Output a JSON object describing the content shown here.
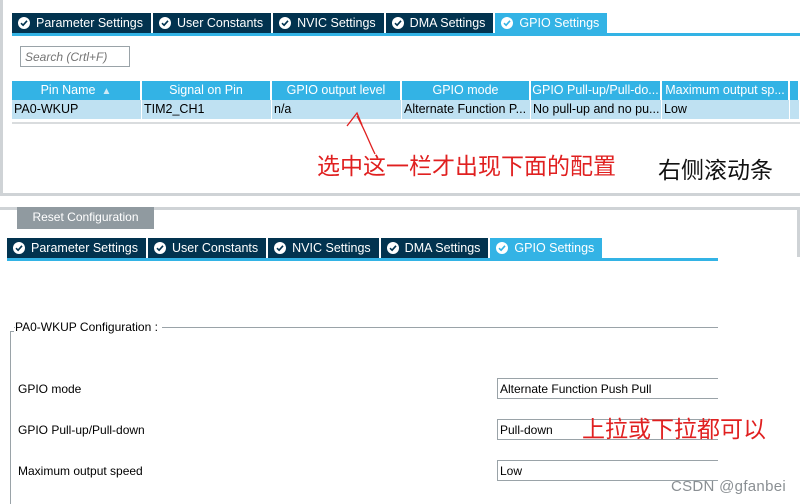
{
  "tabs": [
    {
      "label": "Parameter Settings",
      "active": false
    },
    {
      "label": "User Constants",
      "active": false
    },
    {
      "label": "NVIC Settings",
      "active": false
    },
    {
      "label": "DMA Settings",
      "active": false
    },
    {
      "label": "GPIO Settings",
      "active": true
    }
  ],
  "search": {
    "placeholder": "Search (Crtl+F)"
  },
  "table": {
    "columns": [
      "Pin Name",
      "Signal on Pin",
      "GPIO output level",
      "GPIO mode",
      "GPIO Pull-up/Pull-do...",
      "Maximum output sp...",
      ""
    ],
    "rows": [
      [
        "PA0-WKUP",
        "TIM2_CH1",
        "n/a",
        "Alternate Function P...",
        "No pull-up and no pu...",
        "Low",
        ""
      ]
    ]
  },
  "annotations": {
    "select_hint": "选中这一栏才出现下面的配置",
    "scroll_hint": "右侧滚动条",
    "pull_hint": "上拉或下拉都可以"
  },
  "reset_button": "Reset Configuration",
  "config": {
    "legend": "PA0-WKUP Configuration :",
    "fields": [
      {
        "label": "GPIO mode",
        "value": "Alternate Function Push Pull"
      },
      {
        "label": "GPIO Pull-up/Pull-down",
        "value": "Pull-down"
      },
      {
        "label": "Maximum output speed",
        "value": "Low"
      }
    ]
  },
  "watermark": "CSDN @gfanbei",
  "colors": {
    "tab_bg": "#02334f",
    "tab_active": "#33b3e5",
    "row_selected": "#bfe1f2",
    "annotation_red": "#e02020"
  }
}
